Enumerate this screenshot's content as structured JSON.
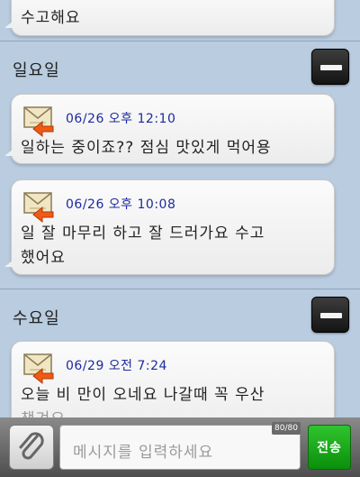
{
  "thread": {
    "top_partial_text": "수고해요",
    "days": [
      {
        "label": "일요일",
        "messages": [
          {
            "meta": "06/26 오후 12:10",
            "text": [
              "일하는 중이죠?? 점심 맛있게 먹어용"
            ]
          },
          {
            "meta": "06/26 오후 10:08",
            "text": [
              "일 잘 마무리 하고 잘 드러가요  수고",
              "했어요"
            ]
          }
        ]
      },
      {
        "label": "수요일",
        "messages": [
          {
            "meta": "06/29 오전 7:24",
            "text": [
              "오늘 비 만이 오네요 나갈때 꼭 우산",
              "챙겨요"
            ]
          }
        ]
      }
    ]
  },
  "icons": {
    "received_mail": "mail-reply-icon",
    "collapse": "minus-icon",
    "attach": "paperclip-icon"
  },
  "composer": {
    "placeholder": "메시지를 입력하세요",
    "counter": "80/80",
    "send_label": "전송"
  },
  "colors": {
    "background": "#b9cce0",
    "meta_text": "#1d2b9f",
    "send_button": "#1aa81a"
  }
}
